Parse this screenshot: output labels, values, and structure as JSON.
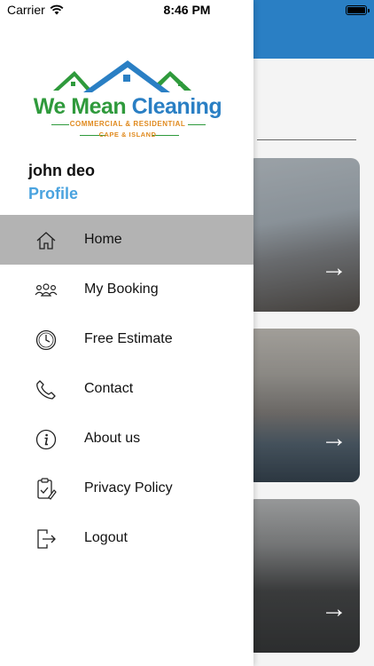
{
  "status_bar": {
    "carrier": "Carrier",
    "time": "8:46 PM"
  },
  "drawer": {
    "logo": {
      "title_part1": "We Mean ",
      "title_part2": "Cleaning",
      "subtitle_line1": "COMMERCIAL & RESIDENTIAL",
      "subtitle_line2": "CAPE & ISLAND",
      "colors": {
        "green": "#2f9a3c",
        "blue": "#2a7fc4",
        "orange": "#e08a1e"
      }
    },
    "user": {
      "name": "john deo",
      "profile_label": "Profile"
    },
    "menu": [
      {
        "label": "Home",
        "icon": "home-icon",
        "active": true
      },
      {
        "label": "My Booking",
        "icon": "group-icon",
        "active": false
      },
      {
        "label": "Free Estimate",
        "icon": "clock-icon",
        "active": false
      },
      {
        "label": "Contact",
        "icon": "phone-icon",
        "active": false
      },
      {
        "label": "About us",
        "icon": "info-icon",
        "active": false
      },
      {
        "label": "Privacy Policy",
        "icon": "policy-icon",
        "active": false
      },
      {
        "label": "Logout",
        "icon": "logout-icon",
        "active": false
      }
    ]
  },
  "background": {
    "header_color": "#2a7fc4",
    "card_arrow_glyph": "→"
  }
}
